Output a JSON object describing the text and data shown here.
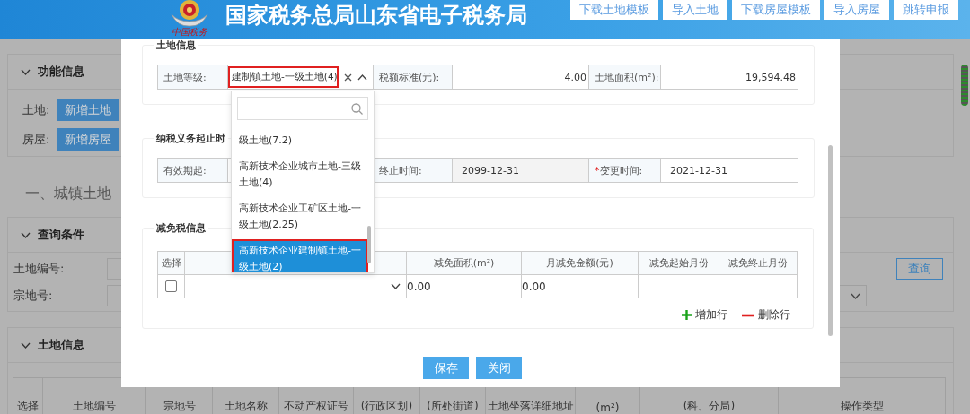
{
  "header": {
    "logo_text": "中国税务",
    "title": "国家税务总局山东省电子税务局",
    "buttons": [
      "下载土地模板",
      "导入土地",
      "下载房屋模板",
      "导入房屋",
      "跳转申报"
    ]
  },
  "background": {
    "function_panel": {
      "title": "功能信息",
      "rows": [
        {
          "label": "土地:",
          "button": "新增土地"
        },
        {
          "label": "房屋:",
          "button": "新增房屋"
        }
      ]
    },
    "section_heading": "一、城镇土地",
    "query_panel": {
      "title": "查询条件",
      "fields": [
        {
          "label": "土地编号:"
        },
        {
          "label": "宗地号:"
        }
      ],
      "query_button": "查询"
    },
    "land_panel": {
      "title": "土地信息",
      "columns": [
        "选择",
        "土地编号",
        "宗地号",
        "土地名称",
        "不动产权证号",
        "(行政区划)",
        "(所处街道)",
        "土地坐落详细地址",
        "(m²)",
        "(科、分局)",
        "操作类型"
      ]
    }
  },
  "dialog": {
    "land_info": {
      "title": "土地信息",
      "grade_label": "土地等级:",
      "grade_value": "建制镇土地-一级土地(4)",
      "grade_highlighted": true,
      "expanded": true,
      "rate_label": "税额标准(元):",
      "rate_value": "4.00",
      "area_label": "土地面积(m²):",
      "area_value": "19,594.48"
    },
    "dropdown": {
      "options": [
        {
          "label": "级土地(7.2)",
          "selected": false,
          "highlighted": false
        },
        {
          "label": "高新技术企业城市土地-三级土地(4)",
          "selected": false,
          "highlighted": false
        },
        {
          "label": "高新技术企业工矿区土地-一级土地(2.25)",
          "selected": false,
          "highlighted": false
        },
        {
          "label": "高新技术企业建制镇土地-一级土地(2)",
          "selected": true,
          "highlighted": true
        }
      ]
    },
    "period": {
      "title": "纳税义务起止时",
      "fields": [
        {
          "label": "有效期起:",
          "disabled": false
        },
        {
          "label": "终止时间:",
          "value": "2099-12-31",
          "disabled": true
        },
        {
          "label": "变更时间:",
          "required_mark": "*",
          "value": "2021-12-31",
          "disabled": false
        }
      ]
    },
    "relief": {
      "title": "减免税信息",
      "columns": [
        {
          "kind": "text",
          "label": "选择"
        },
        {
          "kind": "covered"
        },
        {
          "kind": "text",
          "label": "减免面积(m²)"
        },
        {
          "kind": "text",
          "label": "月减免金额(元)"
        },
        {
          "kind": "text",
          "label": "减免起始月份"
        },
        {
          "kind": "text",
          "label": "减免终止月份"
        }
      ],
      "rows": [
        {
          "checked": false,
          "area": "0.00",
          "monthly": "0.00"
        }
      ],
      "add_label": "增加行",
      "delete_label": "删除行"
    },
    "buttons": [
      "保存",
      "关闭"
    ]
  }
}
